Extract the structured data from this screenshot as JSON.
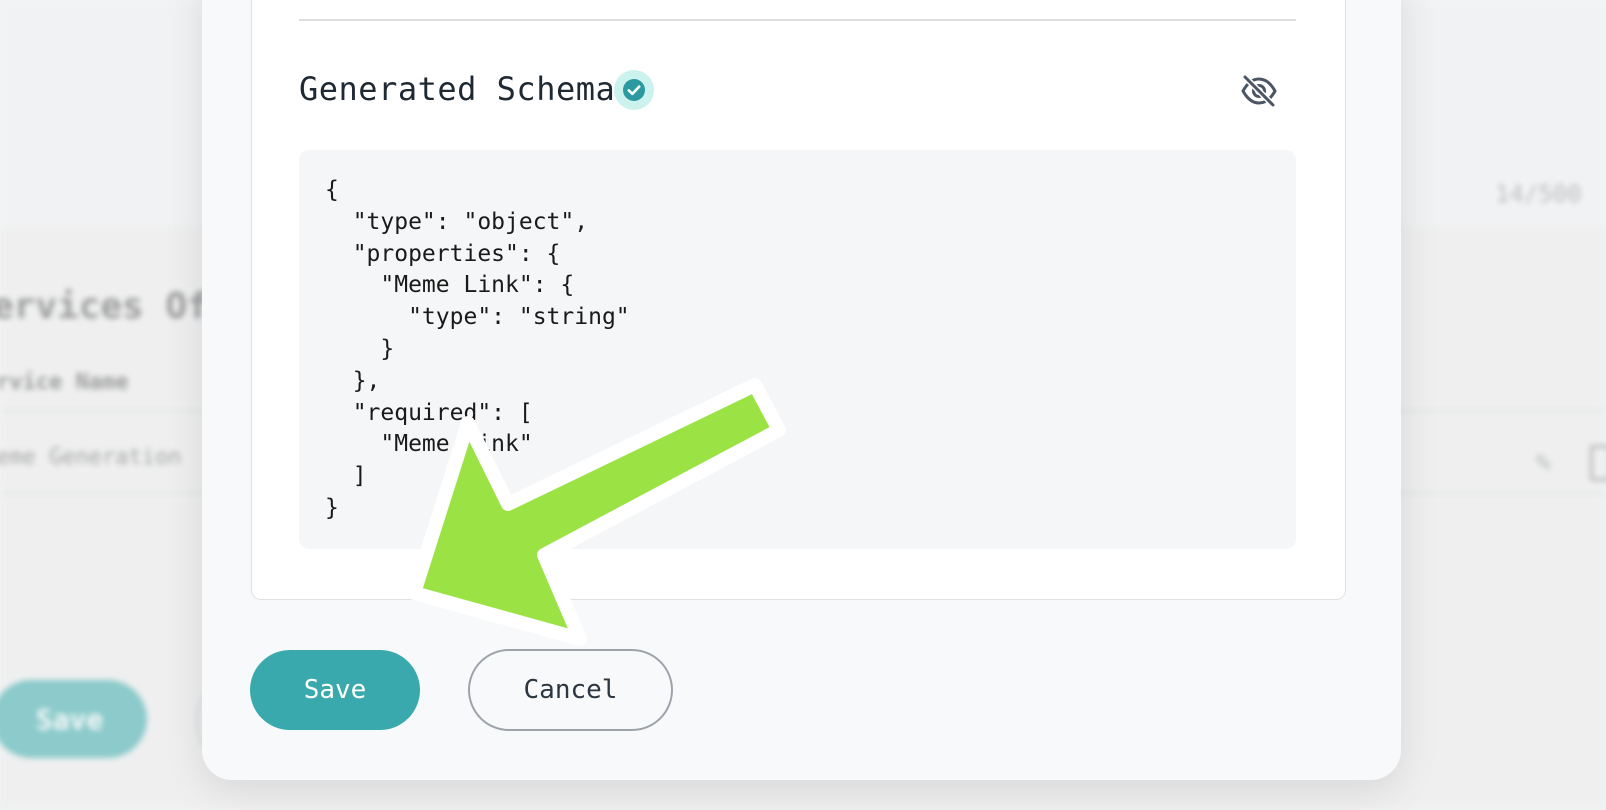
{
  "background": {
    "counter": "14/500",
    "heading": "ervices Of",
    "column_header": "rvice Name",
    "row_name": "eme Generation",
    "save_label": "Save"
  },
  "modal": {
    "schema_title": "Generated Schema",
    "verified_icon": "check-circle-icon",
    "visibility_icon": "eye-off-icon",
    "schema_json": "{\n  \"type\": \"object\",\n  \"properties\": {\n    \"Meme Link\": {\n      \"type\": \"string\"\n    }\n  },\n  \"required\": [\n    \"Meme Link\"\n  ]\n}",
    "save_label": "Save",
    "cancel_label": "Cancel"
  },
  "annotation": {
    "arrow_color": "#9be245",
    "arrow_outline": "#ffffff"
  },
  "colors": {
    "accent": "#3aa9ad",
    "badge_bg": "#ccf2ee"
  }
}
